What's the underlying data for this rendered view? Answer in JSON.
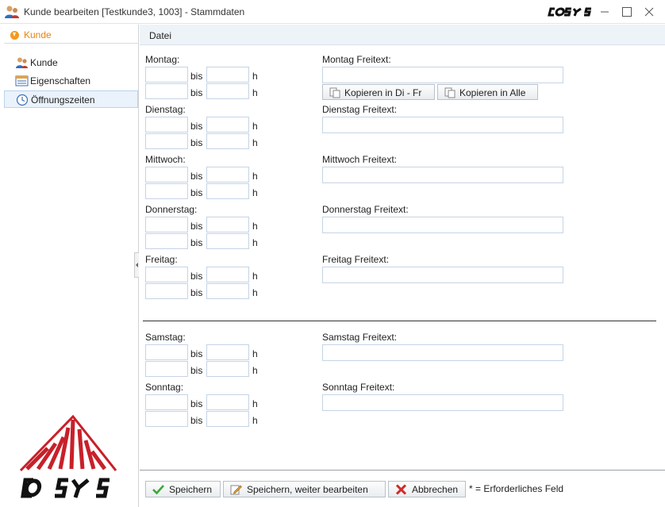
{
  "window": {
    "title": "Kunde bearbeiten [Testkunde3, 1003] - Stammdaten",
    "brand": "COSYS"
  },
  "sidebar": {
    "header": "Kunde",
    "items": [
      {
        "label": "Kunde",
        "icon": "user-group-icon"
      },
      {
        "label": "Eigenschaften",
        "icon": "properties-icon"
      },
      {
        "label": "Öffnungszeiten",
        "icon": "clock-icon",
        "active": true
      }
    ]
  },
  "menu": {
    "file": "Datei"
  },
  "days": {
    "montag": {
      "label": "Montag:",
      "free_label": "Montag Freitext:"
    },
    "dienstag": {
      "label": "Dienstag:",
      "free_label": "Dienstag Freitext:"
    },
    "mittwoch": {
      "label": "Mittwoch:",
      "free_label": "Mittwoch Freitext:"
    },
    "donnerstag": {
      "label": "Donnerstag:",
      "free_label": "Donnerstag Freitext:"
    },
    "freitag": {
      "label": "Freitag:",
      "free_label": "Freitag Freitext:"
    },
    "samstag": {
      "label": "Samstag:",
      "free_label": "Samstag Freitext:"
    },
    "sonntag": {
      "label": "Sonntag:",
      "free_label": "Sonntag Freitext:"
    }
  },
  "time": {
    "bis": "bis",
    "unit": "h"
  },
  "copy": {
    "di_fr": "Kopieren in Di - Fr",
    "all": "Kopieren in Alle"
  },
  "footer": {
    "save": "Speichern",
    "save_continue": "Speichern, weiter bearbeiten",
    "cancel": "Abbrechen",
    "required_note": "* = Erforderliches Feld"
  },
  "colors": {
    "accent": "#e8840f",
    "logo_red": "#c8202a",
    "input_border": "#c5d4e5"
  }
}
